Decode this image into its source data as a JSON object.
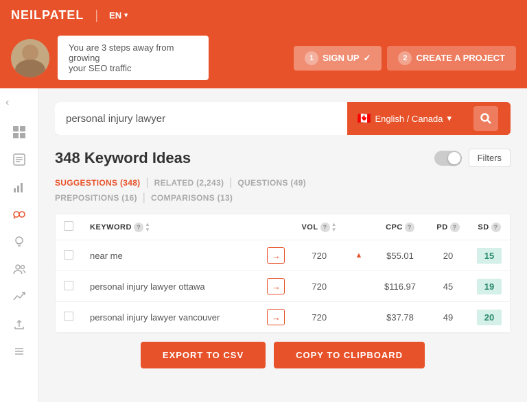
{
  "nav": {
    "logo": "NEILPATEL",
    "lang": "EN",
    "lang_caret": "▾"
  },
  "banner": {
    "message_line1": "You are 3 steps away from growing",
    "message_line2": "your SEO traffic",
    "step1_num": "1",
    "step1_label": "SIGN UP",
    "step1_check": "✓",
    "step2_num": "2",
    "step2_label": "CREATE A PROJECT"
  },
  "search": {
    "placeholder": "personal injury lawyer",
    "value": "personal injury lawyer",
    "lang_flag": "🇨🇦",
    "lang_label": "English / Canada",
    "lang_caret": "▾",
    "search_icon": "🔍"
  },
  "results": {
    "title": "348 Keyword Ideas",
    "filters_label": "Filters"
  },
  "tabs": [
    {
      "label": "SUGGESTIONS (348)",
      "active": true
    },
    {
      "label": "RELATED (2,243)",
      "active": false
    },
    {
      "label": "QUESTIONS (49)",
      "active": false
    },
    {
      "label": "PREPOSITIONS (16)",
      "active": false
    },
    {
      "label": "COMPARISONS (13)",
      "active": false
    }
  ],
  "table": {
    "columns": [
      "KEYWORD",
      "VOL",
      "CPC",
      "PD",
      "SD"
    ],
    "rows": [
      {
        "keyword": "near me",
        "vol": "720",
        "arrow_up": "▲",
        "cpc": "$55.01",
        "pd": "20",
        "sd": "15"
      },
      {
        "keyword": "personal injury lawyer ottawa",
        "vol": "720",
        "cpc": "$116.97",
        "pd": "45",
        "sd": "19"
      },
      {
        "keyword": "personal injury lawyer vancouver",
        "vol": "720",
        "cpc": "$37.78",
        "pd": "49",
        "sd": "20"
      }
    ]
  },
  "actions": {
    "export_label": "EXPORT TO CSV",
    "copy_label": "COPY TO CLIPBOARD"
  },
  "sidebar": {
    "collapse_icon": "‹",
    "items": [
      {
        "icon": "⊞",
        "name": "dashboard"
      },
      {
        "icon": "📋",
        "name": "tasks"
      },
      {
        "icon": "📊",
        "name": "analytics"
      },
      {
        "icon": "🔑",
        "name": "keywords",
        "active": true
      },
      {
        "icon": "💡",
        "name": "ideas"
      },
      {
        "icon": "👥",
        "name": "users"
      },
      {
        "icon": "📈",
        "name": "trends"
      },
      {
        "icon": "⬆",
        "name": "upload"
      },
      {
        "icon": "⊟",
        "name": "list"
      }
    ]
  }
}
